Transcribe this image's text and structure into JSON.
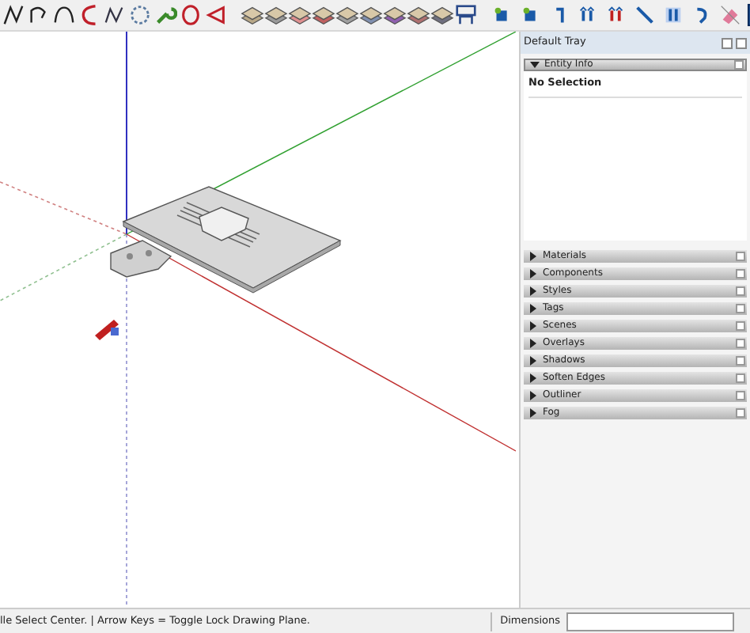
{
  "tray": {
    "title": "Default Tray",
    "panels": [
      {
        "title": "Entity Info",
        "expanded": true,
        "content": "No Selection"
      },
      {
        "title": "Materials",
        "expanded": false
      },
      {
        "title": "Components",
        "expanded": false
      },
      {
        "title": "Styles",
        "expanded": false
      },
      {
        "title": "Tags",
        "expanded": false
      },
      {
        "title": "Scenes",
        "expanded": false
      },
      {
        "title": "Overlays",
        "expanded": false
      },
      {
        "title": "Shadows",
        "expanded": false
      },
      {
        "title": "Soften Edges",
        "expanded": false
      },
      {
        "title": "Outliner",
        "expanded": false
      },
      {
        "title": "Fog",
        "expanded": false
      }
    ]
  },
  "status_bar": {
    "message": "lle Select Center. | Arrow Keys = Toggle Lock Drawing Plane.",
    "measurement_label": "Dimensions"
  }
}
